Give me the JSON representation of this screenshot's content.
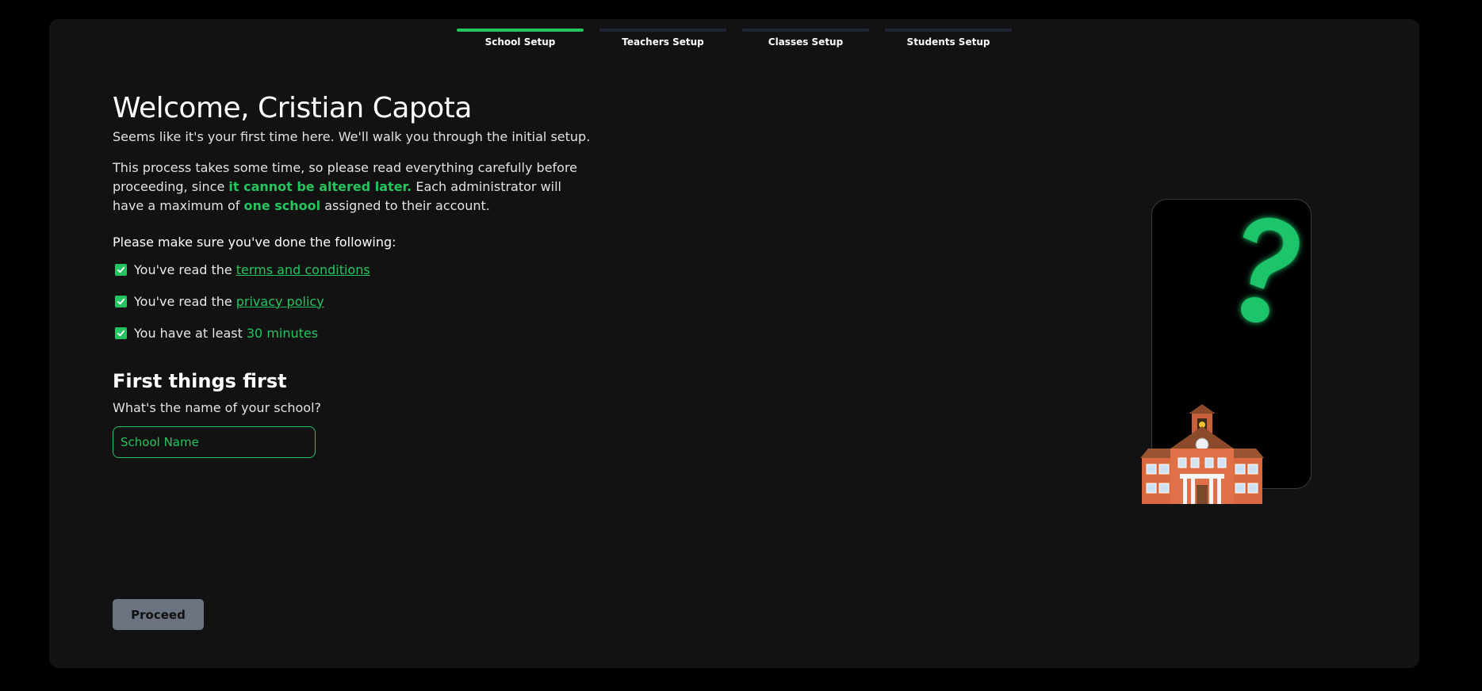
{
  "steps": [
    {
      "label": "School Setup",
      "active": true
    },
    {
      "label": "Teachers Setup",
      "active": false
    },
    {
      "label": "Classes Setup",
      "active": false
    },
    {
      "label": "Students Setup",
      "active": false
    }
  ],
  "welcome": {
    "title": "Welcome, Cristian Capota",
    "subtitle": "Seems like it's your first time here. We'll walk you through the initial setup.",
    "para_part1": "This process takes some time, so please read everything carefully before proceeding, since ",
    "para_highlight1": "it cannot be altered later.",
    "para_part2": " Each administrator will have a maximum of ",
    "para_highlight2": "one school",
    "para_part3": " assigned to their account."
  },
  "checklist": {
    "title": "Please make sure you've done the following:",
    "items": [
      {
        "text": "You've read the",
        "link": "terms and conditions",
        "checked": true
      },
      {
        "text": "You've read the",
        "link": "privacy policy",
        "checked": true
      },
      {
        "text": "You have at least",
        "highlight": "30 minutes",
        "checked": true
      }
    ]
  },
  "form": {
    "heading": "First things first",
    "question": "What's the name of your school?",
    "placeholder": "School Name",
    "value": ""
  },
  "proceed_label": "Proceed",
  "colors": {
    "accent": "#22c55e",
    "card_bg": "#121212",
    "page_bg": "#000000",
    "button_bg": "#6b7280"
  },
  "icons": [
    "check-icon",
    "question-mark-icon",
    "school-building-icon"
  ]
}
